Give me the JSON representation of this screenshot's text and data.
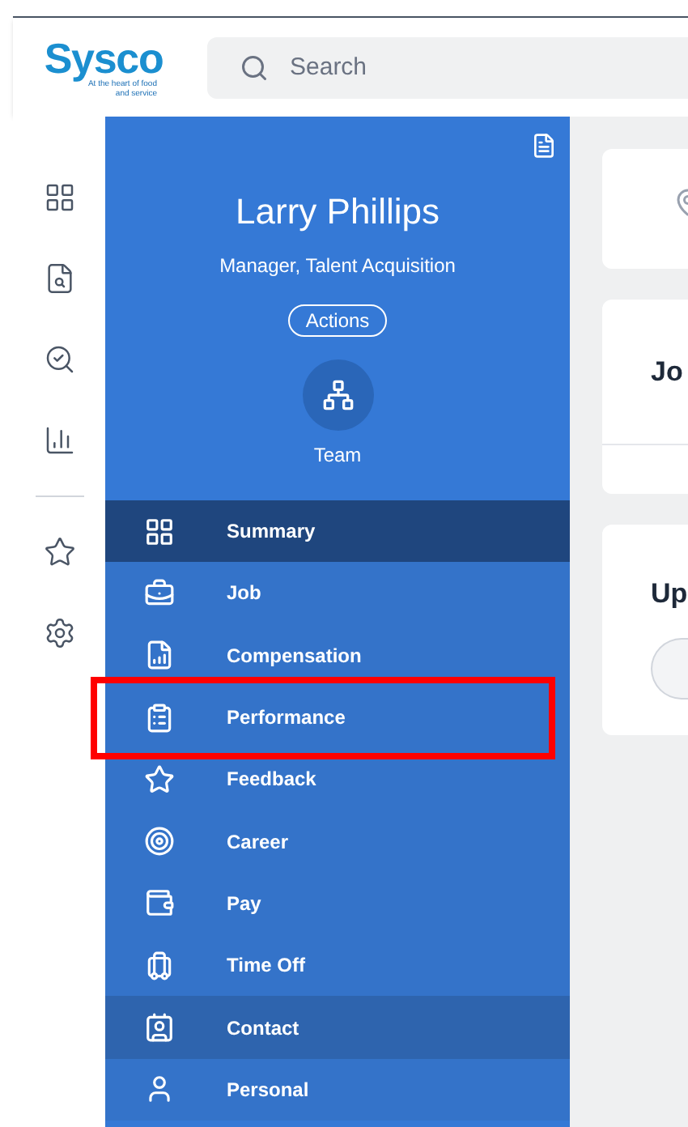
{
  "header": {
    "logo": {
      "name": "Sysco",
      "tagline": "At the heart of food and service"
    },
    "search": {
      "placeholder": "Search"
    }
  },
  "rail": {
    "items": [
      {
        "kind": "dashboard"
      },
      {
        "kind": "profile-search"
      },
      {
        "kind": "person-search"
      },
      {
        "kind": "chart"
      },
      {
        "kind": "divider"
      },
      {
        "kind": "star"
      },
      {
        "kind": "gear"
      }
    ]
  },
  "profile": {
    "name": "Larry Phillips",
    "title": "Manager, Talent Acquisition",
    "actions_button": "Actions",
    "team_label": "Team"
  },
  "nav": [
    {
      "label": "Summary",
      "selected": true,
      "hovered": false,
      "highlighted": false
    },
    {
      "label": "Job",
      "selected": false,
      "hovered": false,
      "highlighted": false
    },
    {
      "label": "Compensation",
      "selected": false,
      "hovered": false,
      "highlighted": false
    },
    {
      "label": "Performance",
      "selected": false,
      "hovered": false,
      "highlighted": true
    },
    {
      "label": "Feedback",
      "selected": false,
      "hovered": false,
      "highlighted": false
    },
    {
      "label": "Career",
      "selected": false,
      "hovered": false,
      "highlighted": false
    },
    {
      "label": "Pay",
      "selected": false,
      "hovered": false,
      "highlighted": false
    },
    {
      "label": "Time Off",
      "selected": false,
      "hovered": false,
      "highlighted": false
    },
    {
      "label": "Contact",
      "selected": false,
      "hovered": true,
      "highlighted": false
    },
    {
      "label": "Personal",
      "selected": false,
      "hovered": false,
      "highlighted": false
    }
  ],
  "content": {
    "cards": [
      {
        "kind": "location"
      },
      {
        "kind": "heading",
        "title": "Jo"
      },
      {
        "kind": "button",
        "title": "Up"
      }
    ]
  }
}
